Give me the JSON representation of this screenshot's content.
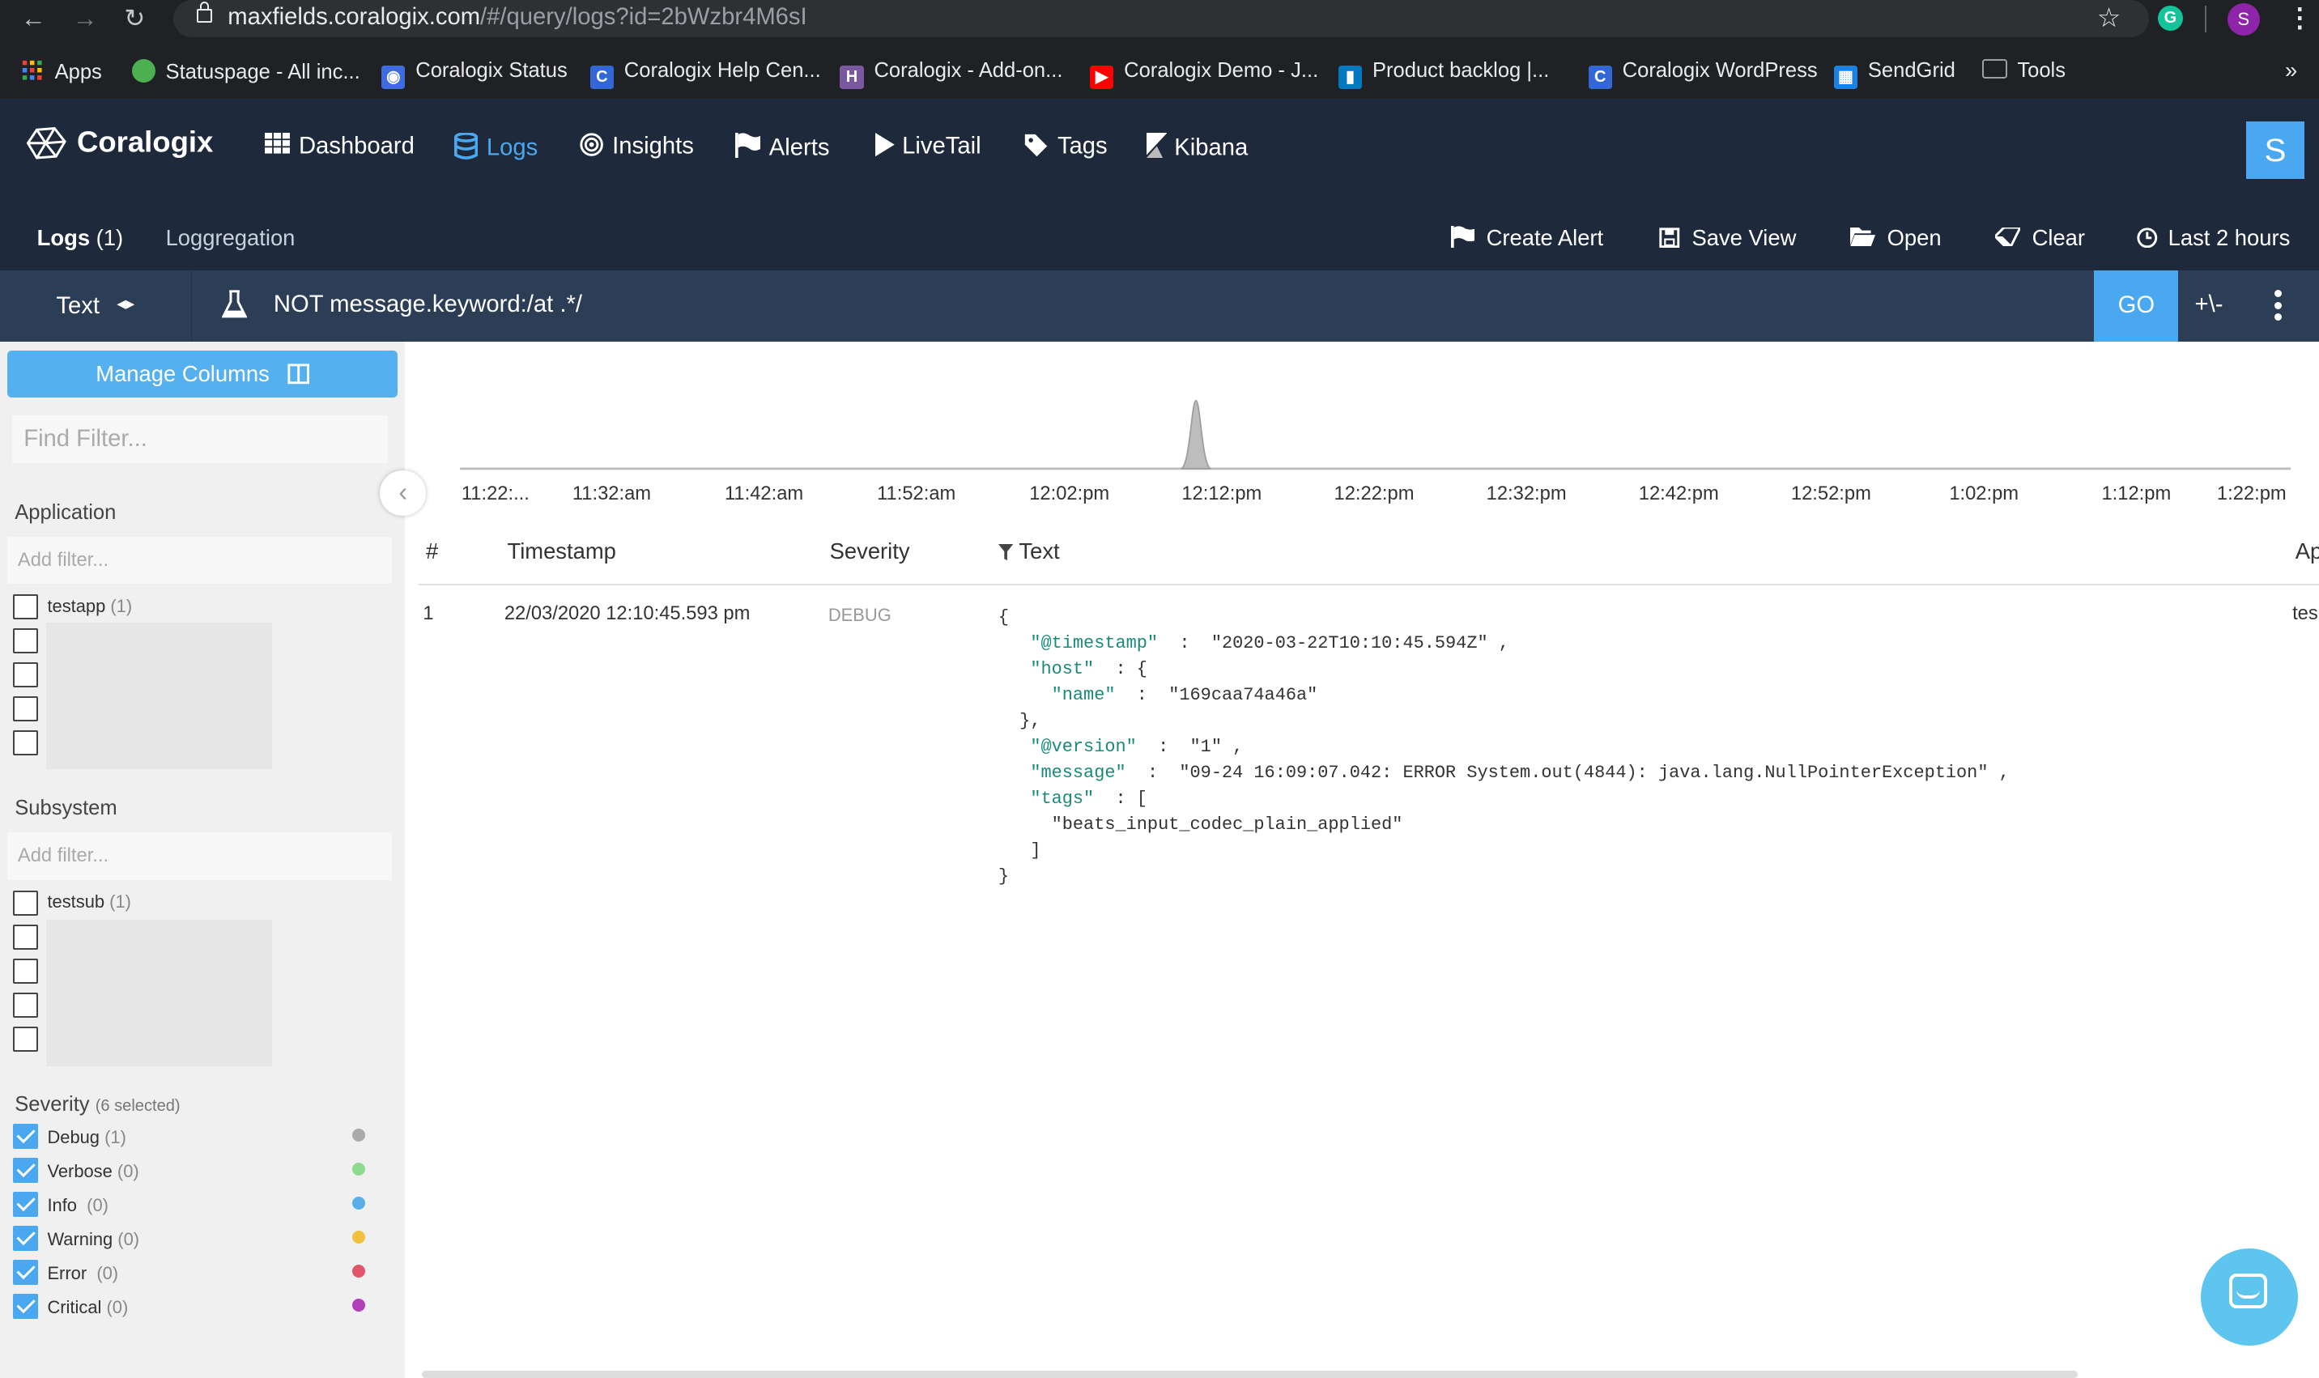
{
  "browser": {
    "url_host": "maxfields.coralogix.com",
    "url_path": "/#/query/logs?id=2bWzbr4M6sI",
    "profile_initial": "S",
    "extension_initial": "G",
    "bookmarks": [
      {
        "label": "Apps",
        "icon": "apps-grid-icon",
        "color": "#ea4335"
      },
      {
        "label": "Statuspage - All inc...",
        "icon": "statuspage-icon",
        "color": "#4caf50"
      },
      {
        "label": "Coralogix Status",
        "icon": "coralogix-status-icon",
        "color": "#3f6ae0"
      },
      {
        "label": "Coralogix Help Cen...",
        "icon": "coralogix-c-icon",
        "color": "#3367d6"
      },
      {
        "label": "Coralogix - Add-on...",
        "icon": "heroku-icon",
        "color": "#79589f"
      },
      {
        "label": "Coralogix Demo - J...",
        "icon": "youtube-icon",
        "color": "#ff0000"
      },
      {
        "label": "Product backlog |...",
        "icon": "trello-icon",
        "color": "#0079bf"
      },
      {
        "label": "Coralogix WordPress",
        "icon": "coralogix-c-icon",
        "color": "#3367d6"
      },
      {
        "label": "SendGrid",
        "icon": "sendgrid-icon",
        "color": "#1a82e2"
      },
      {
        "label": "Tools",
        "icon": "folder-icon",
        "color": "#9aa0a6"
      }
    ],
    "more": "»"
  },
  "header": {
    "brand": "Coralogix",
    "nav": [
      {
        "label": "Dashboard",
        "icon": "grid-icon",
        "active": false
      },
      {
        "label": "Logs",
        "icon": "database-icon",
        "active": true
      },
      {
        "label": "Insights",
        "icon": "target-icon",
        "active": false
      },
      {
        "label": "Alerts",
        "icon": "flag-icon",
        "active": false
      },
      {
        "label": "LiveTail",
        "icon": "play-icon",
        "active": false
      },
      {
        "label": "Tags",
        "icon": "tag-icon",
        "active": false
      },
      {
        "label": "Kibana",
        "icon": "kibana-icon",
        "active": false
      }
    ],
    "user_initial": "S",
    "subnav": {
      "logs": "Logs",
      "logs_count": "(1)",
      "loggregation": "Loggregation"
    },
    "actions": {
      "create_alert": "Create Alert",
      "save_view": "Save View",
      "open": "Open",
      "clear": "Clear",
      "time_range": "Last 2 hours"
    }
  },
  "query": {
    "type": "Text",
    "text": "NOT message.keyword:/at .*/",
    "go": "GO",
    "plus_minus": "+\\-"
  },
  "sidebar": {
    "manage_columns": "Manage Columns",
    "find_filter_placeholder": "Find Filter...",
    "application": {
      "title": "Application",
      "placeholder": "Add filter...",
      "items": [
        {
          "label": "testapp",
          "count": "(1)"
        }
      ]
    },
    "subsystem": {
      "title": "Subsystem",
      "placeholder": "Add filter...",
      "items": [
        {
          "label": "testsub",
          "count": "(1)"
        }
      ]
    },
    "severity": {
      "title": "Severity",
      "selected": "(6 selected)",
      "items": [
        {
          "label": "Debug",
          "count": "(1)",
          "color": "#aaaaaa"
        },
        {
          "label": "Verbose",
          "count": "(0)",
          "color": "#8ddb8d"
        },
        {
          "label": "Info",
          "count": "(0)",
          "color": "#5aaee6"
        },
        {
          "label": "Warning",
          "count": "(0)",
          "color": "#f0c040"
        },
        {
          "label": "Error",
          "count": "(0)",
          "color": "#e0566b"
        },
        {
          "label": "Critical",
          "count": "(0)",
          "color": "#b03fb8"
        }
      ]
    }
  },
  "timeline": {
    "ticks": [
      "11:22:...",
      "11:32:am",
      "11:42:am",
      "11:52:am",
      "12:02:pm",
      "12:12:pm",
      "12:22:pm",
      "12:32:pm",
      "12:42:pm",
      "12:52:pm",
      "1:02:pm",
      "1:12:pm",
      "1:22:pm"
    ],
    "peak_tick_fraction": 0.402
  },
  "table": {
    "columns": {
      "num": "#",
      "timestamp": "Timestamp",
      "severity": "Severity",
      "text": "Text",
      "app": "Ap"
    },
    "rows": [
      {
        "num": "1",
        "timestamp": "22/03/2020 12:10:45.593 pm",
        "severity": "DEBUG",
        "app": "tes",
        "json": {
          "timestamp_key": "\"@timestamp\"",
          "timestamp_val": "\"2020-03-22T10:10:45.594Z\"",
          "host_key": "\"host\"",
          "name_key": "\"name\"",
          "name_val": "\"169caa74a46a\"",
          "version_key": "\"@version\"",
          "version_val": "\"1\"",
          "message_key": "\"message\"",
          "message_val": "\"09-24 16:09:07.042: ERROR System.out(4844): java.lang.NullPointerException\"",
          "tags_key": "\"tags\"",
          "tags_val": "\"beats_input_codec_plain_applied\""
        }
      }
    ]
  }
}
